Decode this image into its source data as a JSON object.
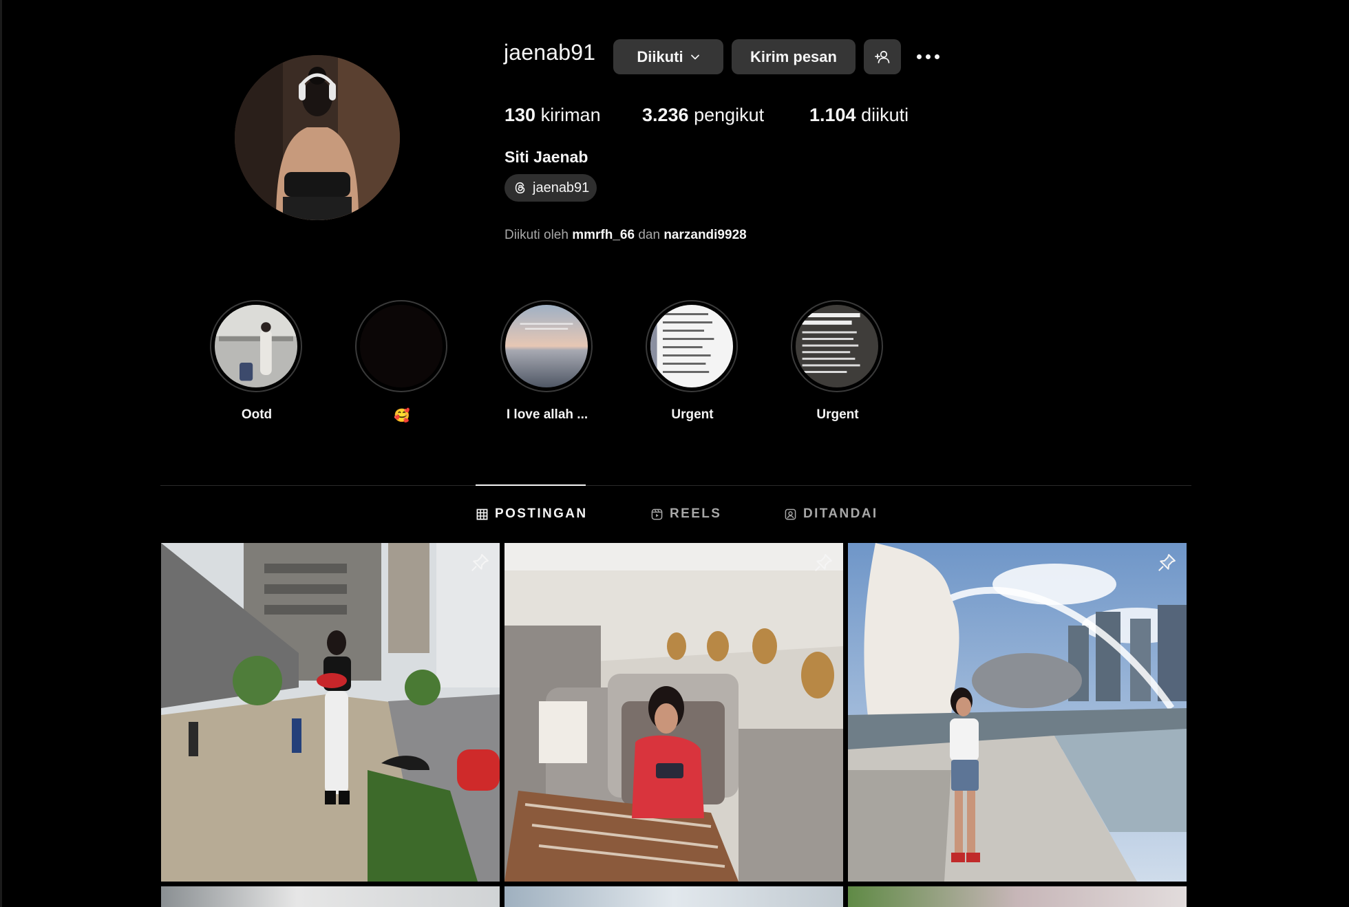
{
  "profile": {
    "username": "jaenab91",
    "follow_button": "Diikuti",
    "message_button": "Kirim pesan",
    "posts_count": "130",
    "posts_label": "kiriman",
    "followers_count": "3.236",
    "followers_label": "pengikut",
    "following_count": "1.104",
    "following_label": "diikuti",
    "full_name": "Siti Jaenab",
    "threads_handle": "jaenab91",
    "followed_by_prefix": "Diikuti oleh",
    "followed_by_user1": "mmrfh_66",
    "followed_by_conj": "dan",
    "followed_by_user2": "narzandi9928"
  },
  "highlights": [
    {
      "label": "Ootd"
    },
    {
      "label": "🥰"
    },
    {
      "label": "I love allah ..."
    },
    {
      "label": "Urgent"
    },
    {
      "label": "Urgent"
    }
  ],
  "tabs": [
    {
      "label": "POSTINGAN",
      "active": true,
      "icon": "grid-icon"
    },
    {
      "label": "REELS",
      "active": false,
      "icon": "reels-icon"
    },
    {
      "label": "DITANDAI",
      "active": false,
      "icon": "tagged-icon"
    }
  ],
  "posts": [
    {
      "scene": "street-photo",
      "pinned": true
    },
    {
      "scene": "airplane-cabin-photo",
      "pinned": true
    },
    {
      "scene": "merlion-photo",
      "pinned": true
    }
  ],
  "colors": {
    "background": "#000000",
    "button": "#363636",
    "secondary_text": "#a8a8a8"
  }
}
